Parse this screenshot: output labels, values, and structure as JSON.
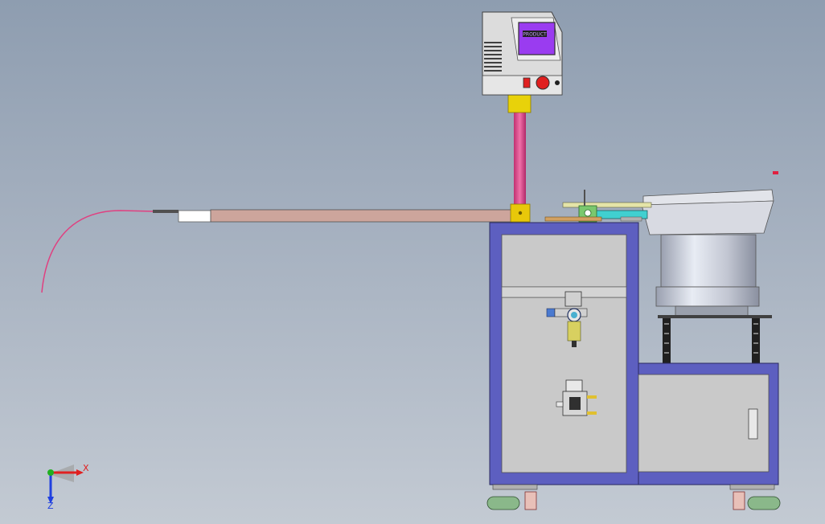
{
  "viewport": {
    "background_top": "#8e9db0",
    "background_bottom": "#c3cad3"
  },
  "triad": {
    "x_label": "X",
    "z_label": "Z",
    "x_color": "#e02020",
    "z_color": "#2040e0",
    "y_color": "#20b020"
  },
  "control_box": {
    "screen_text": "PRODUCT",
    "screen_color": "#9a3cf0",
    "body_color": "#dcdcdc"
  },
  "colors": {
    "frame": "#5d5fc0",
    "panel": "#c9c9c9",
    "conveyor": "#cda59c",
    "column": "#e0508a",
    "collar": "#e8d20a",
    "bowl": "#c8ccd6",
    "wire": "#e04080",
    "feeder_green": "#7ac86e",
    "feeder_cyan": "#40d0d0",
    "indicator_red": "#e02040"
  }
}
